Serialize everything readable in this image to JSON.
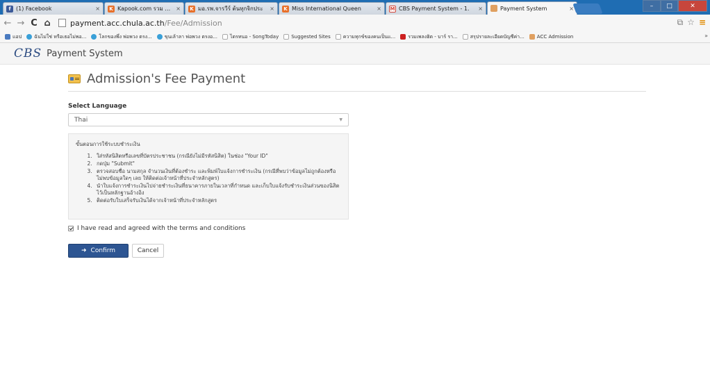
{
  "browser": {
    "tabs": [
      {
        "title": "(1) Facebook",
        "icon": "facebook-icon",
        "color": "#3b5998"
      },
      {
        "title": "Kapook.com รวม ข่าว หนัง",
        "icon": "kapook-icon",
        "color": "#e8702a"
      },
      {
        "title": "มอ.รพ.จารวีร์ ต้นทุกจิกประ",
        "icon": "kapook-icon",
        "color": "#e8702a"
      },
      {
        "title": "Miss International Queen",
        "icon": "kapook-icon",
        "color": "#e8702a"
      },
      {
        "title": "CBS Payment System - 1.",
        "icon": "gmail-icon",
        "color": "#d44638"
      },
      {
        "title": "Payment System",
        "icon": "page-icon",
        "color": "#e0a060"
      }
    ],
    "url_host": "payment.acc.chula.ac.th",
    "url_path": "/Fee/Admission",
    "bookmarks": [
      {
        "label": "แอป",
        "color": "#4a7ac0"
      },
      {
        "label": "ฉันไม่ใช่ หรือเธอไม่พอ...",
        "color": "#3aa0d8"
      },
      {
        "label": "โลกของพึ่ง พ่อพวง ตรง...",
        "color": "#3aa0d8"
      },
      {
        "label": "ขุนเล้าลา พ่อพวง ตรงอ...",
        "color": "#3aa0d8"
      },
      {
        "label": "ไตรทนอ - SongToday",
        "color": "#cccccc"
      },
      {
        "label": "Suggested Sites",
        "color": "#cccccc"
      },
      {
        "label": "ความทุกข์ของคนเป็นแ...",
        "color": "#cccccc"
      },
      {
        "label": "รวมเพลงฮิต - บาร์ รา...",
        "color": "#cc1f1f"
      },
      {
        "label": "สรุปรายละเอียดบัญชีค่า...",
        "color": "#cccccc"
      },
      {
        "label": "ACC Admission",
        "color": "#e0a060"
      }
    ],
    "bookmarks_more": "»"
  },
  "header": {
    "logo": "CBS",
    "title": "Payment System"
  },
  "page": {
    "title": "Admission's Fee Payment",
    "language_label": "Select Language",
    "language_value": "Thai",
    "instructions_heading": "ขั้นตอนการใช้ระบบชำระเงิน",
    "instructions": [
      "ใส่รหัสนิสิตหรือเลขที่บัตรประชาชน (กรณียังไม่มีรหัสนิสิต) ในช่อง \"Your ID\"",
      "กดปุ่ม \"Submit\"",
      "ตรวจสอบชื่อ นามสกุล จำนวนเงินที่ต้องชำระ และพิมพ์ใบแจ้งการชำระเงิน (กรณีที่พบว่าข้อมูลไม่ถูกต้องหรือไม่พบข้อมูลใดๆ เลย ให้ติดต่อเจ้าหน้าที่ประจำหลักสูตร)",
      "นำใบแจ้งการชำระเงินไปจ่ายชำระเงินที่ธนาคารภายในเวลาที่กำหนด และเก็บใบแจ้งรับชำระเงินส่วนของนิสิตไว้เป็นหลักฐานอ้างอิง",
      "ติดต่อรับใบเสร็จรับเงินได้จากเจ้าหน้าที่ประจำหลักสูตร"
    ],
    "agree_label": "I have read and agreed with the terms and conditions",
    "agree_checked": true,
    "confirm_label": "Confirm",
    "cancel_label": "Cancel"
  },
  "colors": {
    "primary": "#2d5592",
    "tabbar": "#1f6db3",
    "logo": "#2a4a80"
  }
}
